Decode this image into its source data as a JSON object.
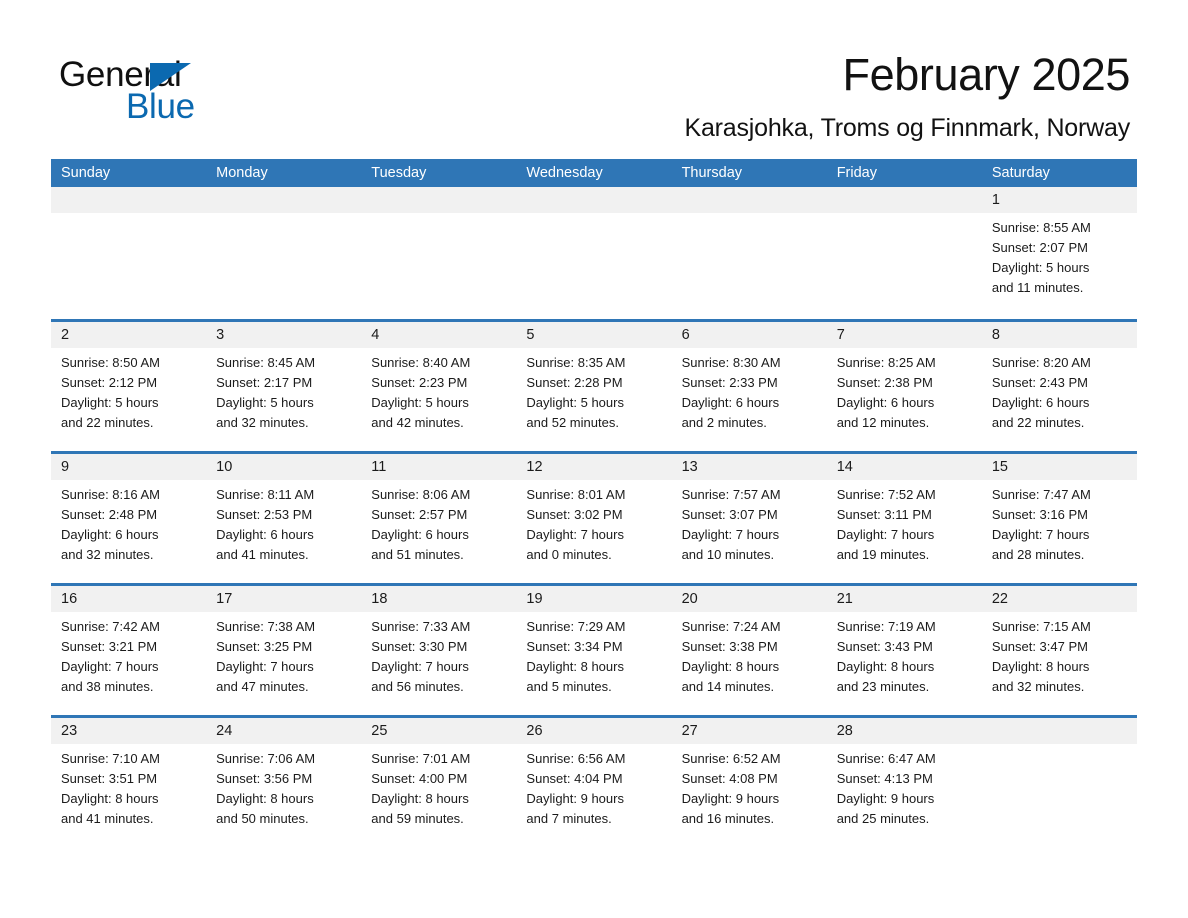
{
  "brand": {
    "word1": "General",
    "word2": "Blue",
    "triangle_color": "#0b69b0"
  },
  "header": {
    "month_title": "February 2025",
    "location": "Karasjohka, Troms og Finnmark, Norway"
  },
  "theme": {
    "header_blue": "#2f76b6",
    "daynum_band": "#f1f1f1",
    "text": "#1b1b1b"
  },
  "weekday_headers": [
    "Sunday",
    "Monday",
    "Tuesday",
    "Wednesday",
    "Thursday",
    "Friday",
    "Saturday"
  ],
  "weeks": [
    [
      {
        "day": "",
        "sunrise": "",
        "sunset": "",
        "daylight1": "",
        "daylight2": "",
        "empty": true
      },
      {
        "day": "",
        "sunrise": "",
        "sunset": "",
        "daylight1": "",
        "daylight2": "",
        "empty": true
      },
      {
        "day": "",
        "sunrise": "",
        "sunset": "",
        "daylight1": "",
        "daylight2": "",
        "empty": true
      },
      {
        "day": "",
        "sunrise": "",
        "sunset": "",
        "daylight1": "",
        "daylight2": "",
        "empty": true
      },
      {
        "day": "",
        "sunrise": "",
        "sunset": "",
        "daylight1": "",
        "daylight2": "",
        "empty": true
      },
      {
        "day": "",
        "sunrise": "",
        "sunset": "",
        "daylight1": "",
        "daylight2": "",
        "empty": true
      },
      {
        "day": "1",
        "sunrise": "Sunrise: 8:55 AM",
        "sunset": "Sunset: 2:07 PM",
        "daylight1": "Daylight: 5 hours",
        "daylight2": "and 11 minutes.",
        "empty": false
      }
    ],
    [
      {
        "day": "2",
        "sunrise": "Sunrise: 8:50 AM",
        "sunset": "Sunset: 2:12 PM",
        "daylight1": "Daylight: 5 hours",
        "daylight2": "and 22 minutes.",
        "empty": false
      },
      {
        "day": "3",
        "sunrise": "Sunrise: 8:45 AM",
        "sunset": "Sunset: 2:17 PM",
        "daylight1": "Daylight: 5 hours",
        "daylight2": "and 32 minutes.",
        "empty": false
      },
      {
        "day": "4",
        "sunrise": "Sunrise: 8:40 AM",
        "sunset": "Sunset: 2:23 PM",
        "daylight1": "Daylight: 5 hours",
        "daylight2": "and 42 minutes.",
        "empty": false
      },
      {
        "day": "5",
        "sunrise": "Sunrise: 8:35 AM",
        "sunset": "Sunset: 2:28 PM",
        "daylight1": "Daylight: 5 hours",
        "daylight2": "and 52 minutes.",
        "empty": false
      },
      {
        "day": "6",
        "sunrise": "Sunrise: 8:30 AM",
        "sunset": "Sunset: 2:33 PM",
        "daylight1": "Daylight: 6 hours",
        "daylight2": "and 2 minutes.",
        "empty": false
      },
      {
        "day": "7",
        "sunrise": "Sunrise: 8:25 AM",
        "sunset": "Sunset: 2:38 PM",
        "daylight1": "Daylight: 6 hours",
        "daylight2": "and 12 minutes.",
        "empty": false
      },
      {
        "day": "8",
        "sunrise": "Sunrise: 8:20 AM",
        "sunset": "Sunset: 2:43 PM",
        "daylight1": "Daylight: 6 hours",
        "daylight2": "and 22 minutes.",
        "empty": false
      }
    ],
    [
      {
        "day": "9",
        "sunrise": "Sunrise: 8:16 AM",
        "sunset": "Sunset: 2:48 PM",
        "daylight1": "Daylight: 6 hours",
        "daylight2": "and 32 minutes.",
        "empty": false
      },
      {
        "day": "10",
        "sunrise": "Sunrise: 8:11 AM",
        "sunset": "Sunset: 2:53 PM",
        "daylight1": "Daylight: 6 hours",
        "daylight2": "and 41 minutes.",
        "empty": false
      },
      {
        "day": "11",
        "sunrise": "Sunrise: 8:06 AM",
        "sunset": "Sunset: 2:57 PM",
        "daylight1": "Daylight: 6 hours",
        "daylight2": "and 51 minutes.",
        "empty": false
      },
      {
        "day": "12",
        "sunrise": "Sunrise: 8:01 AM",
        "sunset": "Sunset: 3:02 PM",
        "daylight1": "Daylight: 7 hours",
        "daylight2": "and 0 minutes.",
        "empty": false
      },
      {
        "day": "13",
        "sunrise": "Sunrise: 7:57 AM",
        "sunset": "Sunset: 3:07 PM",
        "daylight1": "Daylight: 7 hours",
        "daylight2": "and 10 minutes.",
        "empty": false
      },
      {
        "day": "14",
        "sunrise": "Sunrise: 7:52 AM",
        "sunset": "Sunset: 3:11 PM",
        "daylight1": "Daylight: 7 hours",
        "daylight2": "and 19 minutes.",
        "empty": false
      },
      {
        "day": "15",
        "sunrise": "Sunrise: 7:47 AM",
        "sunset": "Sunset: 3:16 PM",
        "daylight1": "Daylight: 7 hours",
        "daylight2": "and 28 minutes.",
        "empty": false
      }
    ],
    [
      {
        "day": "16",
        "sunrise": "Sunrise: 7:42 AM",
        "sunset": "Sunset: 3:21 PM",
        "daylight1": "Daylight: 7 hours",
        "daylight2": "and 38 minutes.",
        "empty": false
      },
      {
        "day": "17",
        "sunrise": "Sunrise: 7:38 AM",
        "sunset": "Sunset: 3:25 PM",
        "daylight1": "Daylight: 7 hours",
        "daylight2": "and 47 minutes.",
        "empty": false
      },
      {
        "day": "18",
        "sunrise": "Sunrise: 7:33 AM",
        "sunset": "Sunset: 3:30 PM",
        "daylight1": "Daylight: 7 hours",
        "daylight2": "and 56 minutes.",
        "empty": false
      },
      {
        "day": "19",
        "sunrise": "Sunrise: 7:29 AM",
        "sunset": "Sunset: 3:34 PM",
        "daylight1": "Daylight: 8 hours",
        "daylight2": "and 5 minutes.",
        "empty": false
      },
      {
        "day": "20",
        "sunrise": "Sunrise: 7:24 AM",
        "sunset": "Sunset: 3:38 PM",
        "daylight1": "Daylight: 8 hours",
        "daylight2": "and 14 minutes.",
        "empty": false
      },
      {
        "day": "21",
        "sunrise": "Sunrise: 7:19 AM",
        "sunset": "Sunset: 3:43 PM",
        "daylight1": "Daylight: 8 hours",
        "daylight2": "and 23 minutes.",
        "empty": false
      },
      {
        "day": "22",
        "sunrise": "Sunrise: 7:15 AM",
        "sunset": "Sunset: 3:47 PM",
        "daylight1": "Daylight: 8 hours",
        "daylight2": "and 32 minutes.",
        "empty": false
      }
    ],
    [
      {
        "day": "23",
        "sunrise": "Sunrise: 7:10 AM",
        "sunset": "Sunset: 3:51 PM",
        "daylight1": "Daylight: 8 hours",
        "daylight2": "and 41 minutes.",
        "empty": false
      },
      {
        "day": "24",
        "sunrise": "Sunrise: 7:06 AM",
        "sunset": "Sunset: 3:56 PM",
        "daylight1": "Daylight: 8 hours",
        "daylight2": "and 50 minutes.",
        "empty": false
      },
      {
        "day": "25",
        "sunrise": "Sunrise: 7:01 AM",
        "sunset": "Sunset: 4:00 PM",
        "daylight1": "Daylight: 8 hours",
        "daylight2": "and 59 minutes.",
        "empty": false
      },
      {
        "day": "26",
        "sunrise": "Sunrise: 6:56 AM",
        "sunset": "Sunset: 4:04 PM",
        "daylight1": "Daylight: 9 hours",
        "daylight2": "and 7 minutes.",
        "empty": false
      },
      {
        "day": "27",
        "sunrise": "Sunrise: 6:52 AM",
        "sunset": "Sunset: 4:08 PM",
        "daylight1": "Daylight: 9 hours",
        "daylight2": "and 16 minutes.",
        "empty": false
      },
      {
        "day": "28",
        "sunrise": "Sunrise: 6:47 AM",
        "sunset": "Sunset: 4:13 PM",
        "daylight1": "Daylight: 9 hours",
        "daylight2": "and 25 minutes.",
        "empty": false
      },
      {
        "day": "",
        "sunrise": "",
        "sunset": "",
        "daylight1": "",
        "daylight2": "",
        "empty": true
      }
    ]
  ]
}
